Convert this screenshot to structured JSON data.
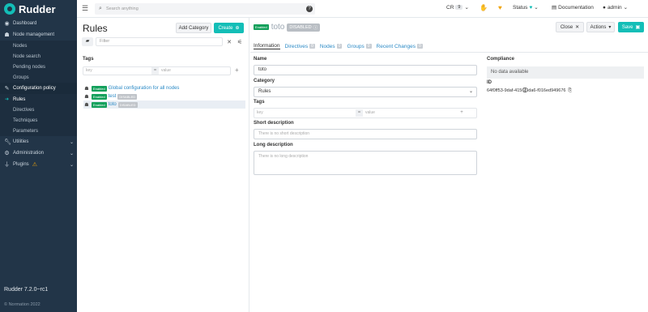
{
  "sidebar": {
    "brand": "Rudder",
    "items": [
      {
        "label": "Dashboard",
        "icon": "dashboard-icon"
      },
      {
        "label": "Node management",
        "icon": "sitemap-icon"
      },
      {
        "label": "Configuration policy",
        "icon": "pencil-icon"
      },
      {
        "label": "Utilities",
        "icon": "wrench-icon"
      },
      {
        "label": "Administration",
        "icon": "gear-icon"
      },
      {
        "label": "Plugins",
        "icon": "plug-icon"
      }
    ],
    "node_sub": [
      "Nodes",
      "Node search",
      "Pending nodes",
      "Groups"
    ],
    "config_sub": [
      "Rules",
      "Directives",
      "Techniques",
      "Parameters"
    ],
    "version": "Rudder 7.2.0~rc1",
    "copyright": "© Normation 2022"
  },
  "topbar": {
    "search_placeholder": "Search anything",
    "cr_label": "CR",
    "cr_count": "9",
    "status_label": "Status",
    "documentation": "Documentation",
    "user": "admin"
  },
  "rules_panel": {
    "title": "Rules",
    "add_category": "Add Category",
    "create": "Create",
    "filter_placeholder": "Filter",
    "tags_label": "Tags",
    "tag_key_placeholder": "key",
    "tag_value_placeholder": "value",
    "enabled_badge": "Enabled",
    "disabled_badge": "DISABLED",
    "tree": [
      {
        "label": "Global configuration for all nodes",
        "badge": "Enabled",
        "disabled": ""
      },
      {
        "label": "test",
        "badge": "Enabled",
        "disabled": "DISABLED"
      },
      {
        "label": "toto",
        "badge": "Enabled",
        "disabled": "DISABLED"
      }
    ]
  },
  "detail": {
    "badge": "Enabled",
    "name": "toto",
    "status": "DISABLED",
    "close": "Close",
    "actions": "Actions",
    "save": "Save",
    "tabs": [
      {
        "label": "Information",
        "count": ""
      },
      {
        "label": "Directives",
        "count": "0"
      },
      {
        "label": "Nodes",
        "count": "0"
      },
      {
        "label": "Groups",
        "count": "0"
      },
      {
        "label": "Recent Changes",
        "count": "0"
      }
    ],
    "name_label": "Name",
    "name_value": "toto",
    "category_label": "Category",
    "category_value": "Rules",
    "tags_label": "Tags",
    "tag_key_placeholder": "key",
    "tag_value_placeholder": "value",
    "short_desc_label": "Short description",
    "short_desc_placeholder": "There is no short description",
    "long_desc_label": "Long description",
    "long_desc_placeholder": "There is no long description",
    "compliance_label": "Compliance",
    "compliance_value": "No data available",
    "id_label": "ID",
    "id_value": "64f0ff53-9daf-4156-9da6-f016ed949676"
  }
}
